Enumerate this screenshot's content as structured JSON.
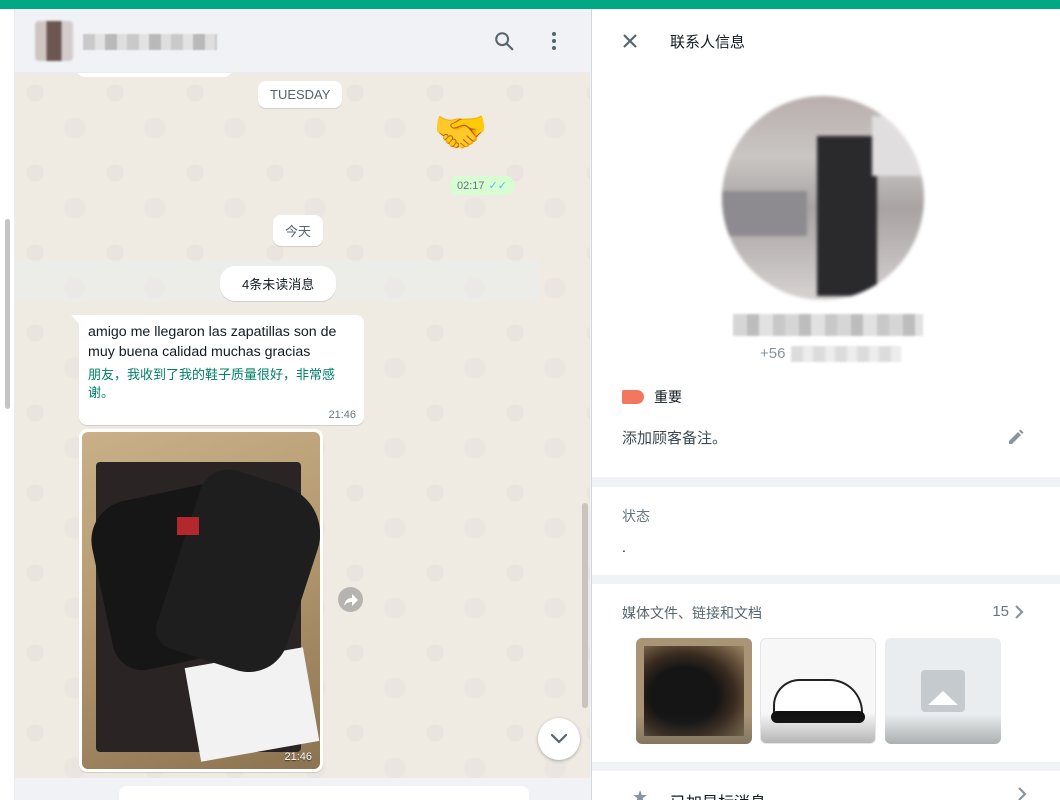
{
  "chat": {
    "date_chip_1": "TUESDAY",
    "emoji_message": "🤝",
    "emoji_time": "02:17",
    "date_chip_2": "今天",
    "unread_banner": "4条未读消息",
    "incoming_message": {
      "text": "amigo me llegaron las zapatillas son de muy buena calidad muchas gracias",
      "translation": "朋友，我收到了我的鞋子质量很好，非常感谢。",
      "time": "21:46"
    },
    "image_message": {
      "time": "21:46"
    }
  },
  "contact_panel": {
    "title": "联系人信息",
    "phone_prefix": "+56",
    "label": {
      "text": "重要",
      "color": "#f2775e"
    },
    "note_placeholder": "添加顾客备注。",
    "status": {
      "label": "状态",
      "value": "."
    },
    "media": {
      "label": "媒体文件、链接和文档",
      "count": "15"
    },
    "starred": {
      "label": "已加星标消息"
    }
  },
  "colors": {
    "accent": "#00a884",
    "outgoing_bubble": "#d9fdd3",
    "translation_text": "#008069",
    "read_ticks": "#53bdeb"
  },
  "icons": {
    "search": "search-icon",
    "menu": "menu-icon",
    "close": "close-icon",
    "edit": "pencil-icon",
    "forward": "forward-icon",
    "scroll_down": "chevron-down-icon",
    "star": "star-icon"
  }
}
